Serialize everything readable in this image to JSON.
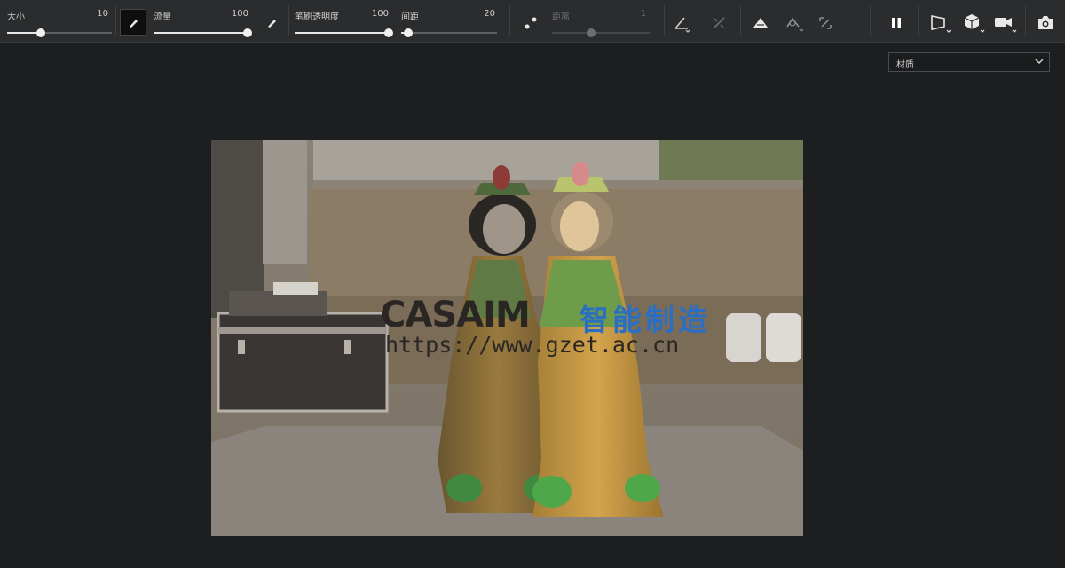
{
  "toolbar": {
    "size": {
      "label": "大小",
      "value": "10",
      "fraction": 0.32
    },
    "flow": {
      "label": "流量",
      "value": "100",
      "fraction": 1.0
    },
    "pressure": {
      "label": "笔刷透明度",
      "value": "100",
      "fraction": 1.0
    },
    "spacing": {
      "label": "间距",
      "value": "20",
      "fraction": 0.07
    },
    "distance": {
      "label": "距离",
      "value": "1",
      "fraction": 0.4,
      "disabled": true
    },
    "icons": [
      "brush-icon",
      "smudge-icon",
      "points-icon",
      "angle-icon",
      "line-icon",
      "mesh-icon",
      "lasso-icon",
      "crop-icon",
      "pause-icon",
      "perspective-icon",
      "cube-icon",
      "camera-video-icon",
      "screenshot-icon"
    ]
  },
  "material_select": {
    "value": "材质"
  },
  "viewport": {
    "watermark_brand": "CASAIM",
    "watermark_cn": "智能制造",
    "watermark_url": "https://www.gzet.ac.cn"
  },
  "colors": {
    "background": "#1d1e20",
    "toolbar": "#2b2c2e",
    "brand_blue": "#2b6fc2"
  }
}
